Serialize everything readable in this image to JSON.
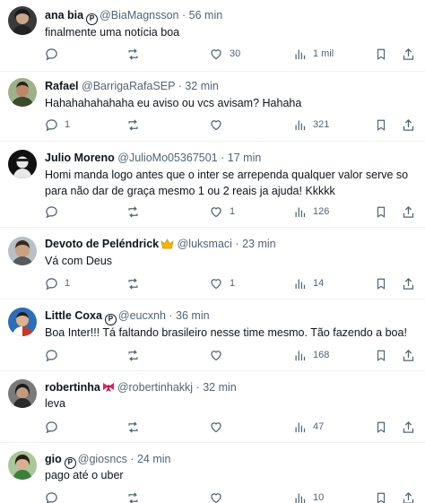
{
  "tweets": [
    {
      "name": "ana bia",
      "verified": true,
      "handle": "@BiaMagnsson",
      "time": "56 min",
      "text": "finalmente uma notícia boa",
      "replies": "",
      "retweets": "",
      "likes": "30",
      "views": "1 mil",
      "avatar_color": "#3a3a3a"
    },
    {
      "name": "Rafael",
      "verified": false,
      "handle": "@BarrigaRafaSEP",
      "time": "32 min",
      "text": "Hahahahahahaha eu aviso ou vcs avisam? Hahaha",
      "replies": "1",
      "retweets": "",
      "likes": "",
      "views": "321",
      "avatar_color": "#6d7b4e"
    },
    {
      "name": "Julio Moreno",
      "verified": false,
      "handle": "@JulioMo05367501",
      "time": "17 min",
      "text": "Homi manda logo antes que o inter se arrependa qualquer valor serve so para não dar de graça mesmo 1 ou 2 reais ja ajuda! Kkkkk",
      "replies": "",
      "retweets": "",
      "likes": "1",
      "views": "126",
      "avatar_color": "#111111"
    },
    {
      "name": "Devoto de Peléndrick",
      "emoji": "crown-icon",
      "verified": false,
      "handle": "@luksmaci",
      "time": "23 min",
      "text": "Vá com Deus",
      "replies": "1",
      "retweets": "",
      "likes": "1",
      "views": "14",
      "avatar_color": "#8a8f92"
    },
    {
      "name": "Little Coxa",
      "verified": true,
      "handle": "@eucxnh",
      "time": "36 min",
      "text": "Boa Inter!!! Tá faltando brasileiro nesse time mesmo. Tão fazendo a boa!",
      "replies": "",
      "retweets": "",
      "likes": "",
      "views": "168",
      "avatar_color": "#1d4e8f"
    },
    {
      "name": "robertinha",
      "emoji": "ribbon-icon",
      "verified": false,
      "handle": "@robertinhakkj",
      "time": "32 min",
      "text": "leva",
      "replies": "",
      "retweets": "",
      "likes": "",
      "views": "47",
      "avatar_color": "#4a4a4a"
    },
    {
      "name": "gio",
      "verified": true,
      "handle": "@giosncs",
      "time": "24 min",
      "text": "pago até o uber",
      "replies": "",
      "retweets": "",
      "likes": "",
      "views": "10",
      "avatar_color": "#8fae7c"
    }
  ],
  "dot": "·",
  "verified_glyph": "P",
  "colors": {
    "text": "#0f1419",
    "secondary": "#536471",
    "divider": "#eff3f4"
  }
}
